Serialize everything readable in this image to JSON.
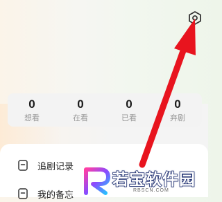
{
  "header": {
    "settings_icon": "settings-hexagon-icon"
  },
  "stats": [
    {
      "value": "0",
      "label": "想看"
    },
    {
      "value": "0",
      "label": "在看"
    },
    {
      "value": "0",
      "label": "已看"
    },
    {
      "value": "0",
      "label": "弃剧"
    }
  ],
  "menu": {
    "items": [
      {
        "label": "追剧记录",
        "icon": "document-icon"
      },
      {
        "label": "我的备忘",
        "icon": "document-icon"
      }
    ]
  },
  "watermark": {
    "brand": "若宝软件园",
    "site": "RBSCN.COM"
  },
  "colors": {
    "arrow": "#e8141e",
    "watermark_outline": "#1b2c6e"
  }
}
